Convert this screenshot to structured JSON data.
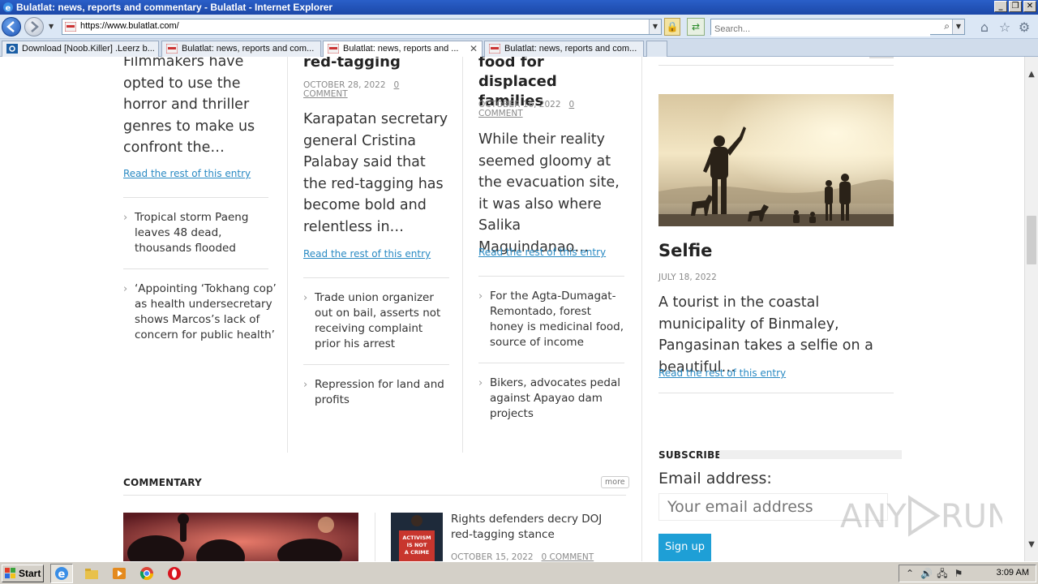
{
  "window": {
    "title": "Bulatlat: news, reports and commentary - Bulatlat - Internet Explorer",
    "buttons": {
      "minimize": "_",
      "restore": "❐",
      "close": "✕"
    }
  },
  "address_bar": {
    "url": "https://www.bulatlat.com/",
    "search_placeholder": "Search..."
  },
  "tabs": [
    {
      "label": "Download [Noob.Killer] .Leerz b...",
      "active": false
    },
    {
      "label": "Bulatlat: news, reports and com...",
      "active": false
    },
    {
      "label": "Bulatlat: news, reports and ...",
      "active": true
    },
    {
      "label": "Bulatlat: news, reports and com...",
      "active": false
    }
  ],
  "page": {
    "col1": {
      "excerpt": "Filmmakers have opted to use the horror and thriller genres to make us confront the…",
      "read_more": "Read the rest of this entry",
      "list": [
        "Tropical storm Paeng leaves 48 dead, thousands flooded",
        "‘Appointing ‘Tokhang cop’ as health undersecretary shows Marcos’s lack of concern for public health’"
      ]
    },
    "col2": {
      "headline_tail": "red-tagging",
      "date": "OCTOBER 28, 2022",
      "comments": "0 COMMENT",
      "excerpt": "Karapatan secretary general Cristina Palabay said that the red-tagging has become bold and relentless in…",
      "read_more": "Read the rest of this entry",
      "list": [
        "Trade union organizer out on bail, asserts not receiving complaint prior his arrest",
        "Repression for land and profits"
      ]
    },
    "col3": {
      "headline_tail": "food for displaced families",
      "date": "OCTOBER 16, 2022",
      "comments": "0 COMMENT",
      "excerpt": "While their reality seemed gloomy at the evacuation site, it was also where Salika Maguindanao…",
      "read_more": "Read the rest of this entry",
      "list": [
        "For the Agta-Dumagat-Remontado, forest honey is medicinal food, source of income",
        "Bikers, advocates pedal against Apayao dam projects"
      ]
    },
    "sidebar": {
      "photo_title": "Selfie",
      "photo_date": "JULY 18, 2022",
      "photo_excerpt": "A tourist in the coastal municipality of Binmaley, Pangasinan takes a selfie on a beautiful…",
      "read_more": "Read the rest of this entry",
      "subscribe_title": "SUBSCRIBE",
      "email_label": "Email address:",
      "email_placeholder": "Your email address",
      "signup": "Sign up"
    },
    "commentary": {
      "title": "COMMENTARY",
      "more": "more",
      "item_title": "Rights defenders decry DOJ red-tagging stance",
      "item_date": "OCTOBER 15, 2022",
      "item_comments": "0 COMMENT",
      "sign_text": "ACTIVISM IS NOT A CRIME"
    }
  },
  "taskbar": {
    "start": "Start",
    "clock": "3:09 AM"
  },
  "watermark": "ANY RUN",
  "colors": {
    "link": "#2a8ac3",
    "signup_bg": "#1e9fd6",
    "title_bar": "#1c48a8"
  }
}
